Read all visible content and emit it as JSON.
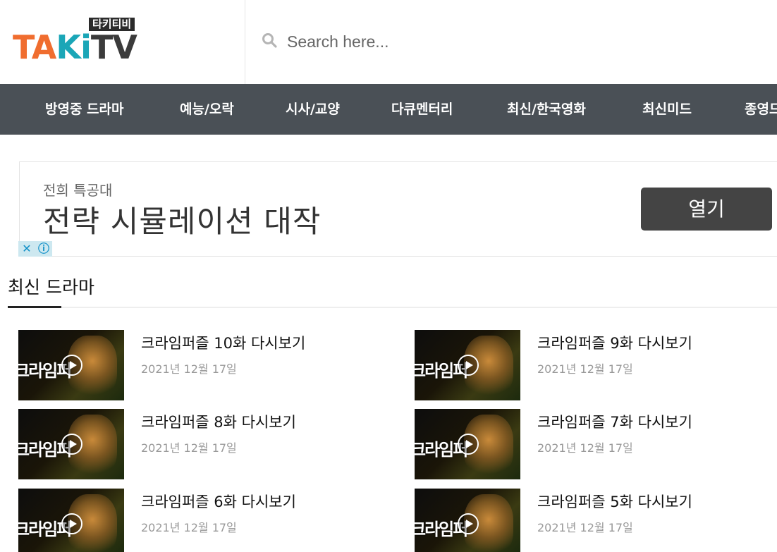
{
  "logo": {
    "badge": "타키티비",
    "part1": "TA",
    "part2": "Ki",
    "part3": "TV"
  },
  "search": {
    "placeholder": "Search here..."
  },
  "nav": {
    "items": [
      "방영중 드라마",
      "예능/오락",
      "시사/교양",
      "다큐멘터리",
      "최신/한국영화",
      "최신미드",
      "종영드"
    ]
  },
  "ad": {
    "small_text": "전희 특공대",
    "big_text": "전략 시뮬레이션 대작",
    "button_label": "열기",
    "close_glyph": "✕",
    "info_glyph": "ⓘ"
  },
  "section": {
    "title": "최신 드라마"
  },
  "posts": [
    {
      "title": "크라임퍼즐 10화 다시보기",
      "date": "2021년 12월 17일",
      "thumb_text": "크라임퍼"
    },
    {
      "title": "크라임퍼즐 9화 다시보기",
      "date": "2021년 12월 17일",
      "thumb_text": "크라임퍼"
    },
    {
      "title": "크라임퍼즐 8화 다시보기",
      "date": "2021년 12월 17일",
      "thumb_text": "크라임퍼"
    },
    {
      "title": "크라임퍼즐 7화 다시보기",
      "date": "2021년 12월 17일",
      "thumb_text": "크라임퍼"
    },
    {
      "title": "크라임퍼즐 6화 다시보기",
      "date": "2021년 12월 17일",
      "thumb_text": "크라임퍼"
    },
    {
      "title": "크라임퍼즐 5화 다시보기",
      "date": "2021년 12월 17일",
      "thumb_text": "크라임퍼"
    }
  ],
  "colors": {
    "nav_bg": "#4a5056",
    "logo_orange": "#f06d2f",
    "logo_teal": "#1aa6b7",
    "ad_button": "#444444"
  }
}
